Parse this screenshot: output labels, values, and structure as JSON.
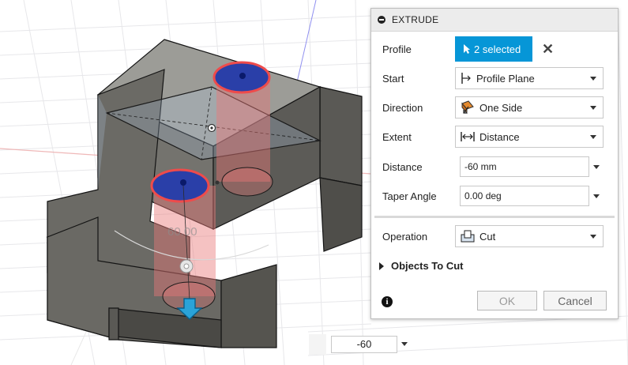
{
  "dialog": {
    "title": "EXTRUDE",
    "profile": {
      "label": "Profile",
      "value": "2 selected"
    },
    "start": {
      "label": "Start",
      "value": "Profile Plane"
    },
    "direction": {
      "label": "Direction",
      "value": "One Side"
    },
    "extent": {
      "label": "Extent",
      "value": "Distance"
    },
    "distance": {
      "label": "Distance",
      "value": "-60 mm"
    },
    "taper": {
      "label": "Taper Angle",
      "value": "0.00 deg"
    },
    "operation": {
      "label": "Operation",
      "value": "Cut"
    },
    "objects_to_cut": "Objects To Cut",
    "ok_label": "OK",
    "cancel_label": "Cancel",
    "info_symbol": "i"
  },
  "viewport": {
    "dimension_label": "60.00"
  },
  "value_input": {
    "value": "-60"
  },
  "colors": {
    "accent": "#0696d7",
    "body": "#6e6d68",
    "cut_volume": "#e89090",
    "profile_fill": "#2a3fa8",
    "axis_red": "#e8a0a0"
  },
  "icons": [
    "collapse-icon",
    "cursor-select-icon",
    "close-icon",
    "profile-plane-icon",
    "one-side-icon",
    "distance-icon",
    "cut-icon",
    "expand-triangle-icon",
    "info-icon",
    "direction-arrow-icon"
  ]
}
